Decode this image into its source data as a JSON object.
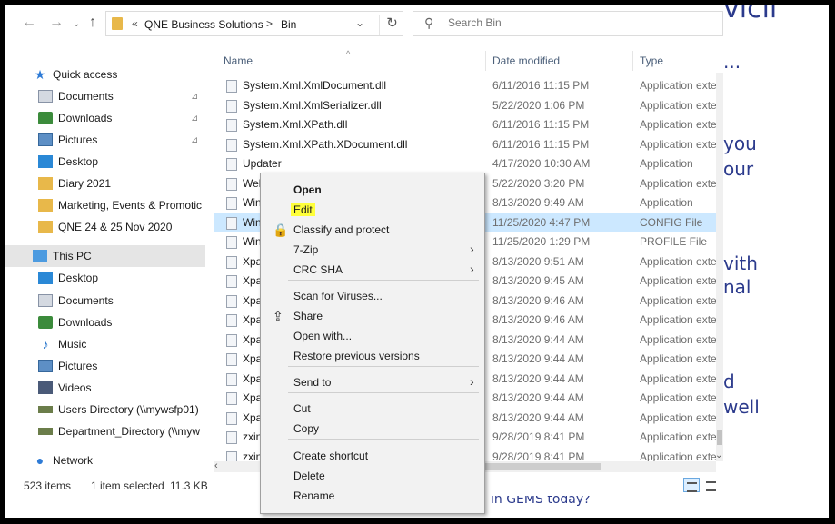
{
  "address_bar": {
    "recent_marker": "«",
    "breadcrumb": [
      "QNE Business Solutions",
      "Bin"
    ],
    "separator": ">",
    "dropdown_glyph": "⌄",
    "refresh_glyph": "↻"
  },
  "search": {
    "placeholder": "Search Bin"
  },
  "nav": {
    "back_glyph": "←",
    "forward_glyph": "→",
    "up_glyph": "↑"
  },
  "sidebar": {
    "items": [
      {
        "label": "Quick access",
        "icon": "star-icon"
      },
      {
        "label": "Documents",
        "icon": "documents-icon",
        "pinned": true
      },
      {
        "label": "Downloads",
        "icon": "downloads-icon",
        "pinned": true
      },
      {
        "label": "Pictures",
        "icon": "pictures-icon",
        "pinned": true
      },
      {
        "label": "Desktop",
        "icon": "desktop-icon"
      },
      {
        "label": "Diary 2021",
        "icon": "folder-icon"
      },
      {
        "label": "Marketing, Events & Promotic",
        "icon": "folder-icon"
      },
      {
        "label": "QNE 24 & 25 Nov 2020",
        "icon": "folder-icon"
      },
      {
        "label": "This PC",
        "icon": "pc-icon"
      },
      {
        "label": "Desktop",
        "icon": "desktop-icon"
      },
      {
        "label": "Documents",
        "icon": "documents-icon"
      },
      {
        "label": "Downloads",
        "icon": "downloads-icon"
      },
      {
        "label": "Music",
        "icon": "music-icon"
      },
      {
        "label": "Pictures",
        "icon": "pictures-icon"
      },
      {
        "label": "Videos",
        "icon": "videos-icon"
      },
      {
        "label": "Users Directory (\\\\mywsfp01)",
        "icon": "network-drive-icon"
      },
      {
        "label": "Department_Directory (\\\\myw",
        "icon": "network-drive-icon"
      },
      {
        "label": "Network",
        "icon": "network-icon"
      }
    ],
    "pin_glyph": "📌"
  },
  "file_list": {
    "columns": {
      "name": "Name",
      "date": "Date modified",
      "type": "Type"
    },
    "sort_glyph": "^",
    "rows": [
      {
        "name": "System.Xml.XmlDocument.dll",
        "date": "6/11/2016 11:15 PM",
        "type": "Application exte"
      },
      {
        "name": "System.Xml.XmlSerializer.dll",
        "date": "5/22/2020 1:06 PM",
        "type": "Application exte"
      },
      {
        "name": "System.Xml.XPath.dll",
        "date": "6/11/2016 11:15 PM",
        "type": "Application exte"
      },
      {
        "name": "System.Xml.XPath.XDocument.dll",
        "date": "6/11/2016 11:15 PM",
        "type": "Application exte"
      },
      {
        "name": "Updater",
        "date": "4/17/2020 10:30 AM",
        "type": "Application"
      },
      {
        "name": "Web",
        "date": "5/22/2020 3:20 PM",
        "type": "Application exte"
      },
      {
        "name": "Win",
        "date": "8/13/2020 9:49 AM",
        "type": "Application"
      },
      {
        "name": "Win",
        "date": "11/25/2020 4:47 PM",
        "type": "CONFIG File"
      },
      {
        "name": "Win",
        "date": "11/25/2020 1:29 PM",
        "type": "PROFILE File"
      },
      {
        "name": "Xpa",
        "date": "8/13/2020 9:51 AM",
        "type": "Application exte"
      },
      {
        "name": "Xpa",
        "date": "8/13/2020 9:45 AM",
        "type": "Application exte"
      },
      {
        "name": "Xpa",
        "date": "8/13/2020 9:46 AM",
        "type": "Application exte"
      },
      {
        "name": "Xpa",
        "date": "8/13/2020 9:46 AM",
        "type": "Application exte"
      },
      {
        "name": "Xpa",
        "date": "8/13/2020 9:44 AM",
        "type": "Application exte"
      },
      {
        "name": "Xpa",
        "date": "8/13/2020 9:44 AM",
        "type": "Application exte"
      },
      {
        "name": "Xpa",
        "date": "8/13/2020 9:44 AM",
        "type": "Application exte"
      },
      {
        "name": "Xpa",
        "date": "8/13/2020 9:44 AM",
        "type": "Application exte"
      },
      {
        "name": "Xpa",
        "date": "8/13/2020 9:44 AM",
        "type": "Application exte"
      },
      {
        "name": "zxin",
        "date": "9/28/2019 8:41 PM",
        "type": "Application exte"
      },
      {
        "name": "zxin",
        "date": "9/28/2019 8:41 PM",
        "type": "Application exte"
      }
    ],
    "selected_row": 7
  },
  "status_bar": {
    "item_count": "523 items",
    "selected": "1 item selected",
    "size": "11.3 KB"
  },
  "context_menu": {
    "items": [
      {
        "label": "Open",
        "bold": true
      },
      {
        "label": "Edit",
        "highlighted": true
      },
      {
        "label": "Classify and protect",
        "icon": "lock-icon"
      },
      {
        "label": "7-Zip",
        "submenu": true
      },
      {
        "label": "CRC SHA",
        "submenu": true
      },
      {
        "label": "Scan for Viruses..."
      },
      {
        "label": "Share",
        "icon": "share-icon"
      },
      {
        "label": "Open with..."
      },
      {
        "label": "Restore previous versions"
      },
      {
        "label": "Send to",
        "submenu": true
      },
      {
        "label": "Cut"
      },
      {
        "label": "Copy"
      },
      {
        "label": "Create shortcut"
      },
      {
        "label": "Delete"
      },
      {
        "label": "Rename"
      }
    ],
    "chevron_glyph": "›",
    "highlight_color": "#ffff3a"
  },
  "background_doc": {
    "lines": [
      "...",
      "you",
      "our",
      "vith",
      "nal",
      "d",
      "well"
    ],
    "partial_top": "vicii",
    "bottom_text": "in GEMS today?"
  },
  "colors": {
    "selection": "#cce8ff",
    "accent": "#2e7bd6",
    "header_text": "#4c607a"
  }
}
